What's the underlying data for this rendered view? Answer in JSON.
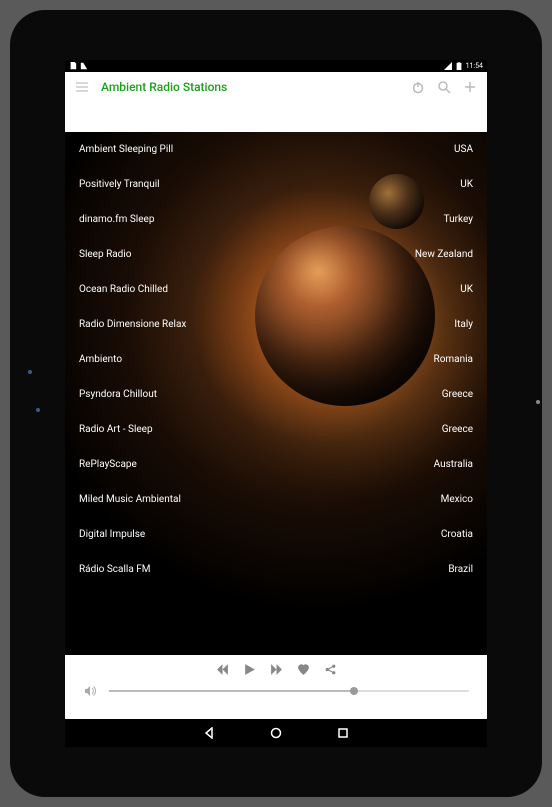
{
  "statusbar": {
    "time": "11:54"
  },
  "header": {
    "title": "Ambient Radio Stations"
  },
  "stations": [
    {
      "name": "Ambient Sleeping Pill",
      "country": "USA"
    },
    {
      "name": "Positively Tranquil",
      "country": "UK"
    },
    {
      "name": "dinamo.fm Sleep",
      "country": "Turkey"
    },
    {
      "name": "Sleep Radio",
      "country": "New Zealand"
    },
    {
      "name": "Ocean Radio Chilled",
      "country": "UK"
    },
    {
      "name": "Radio Dimensione Relax",
      "country": "Italy"
    },
    {
      "name": "Ambiento",
      "country": "Romania"
    },
    {
      "name": "Psyndora Chillout",
      "country": "Greece"
    },
    {
      "name": "Radio Art - Sleep",
      "country": "Greece"
    },
    {
      "name": "RePlayScape",
      "country": "Australia"
    },
    {
      "name": "Miled Music Ambiental",
      "country": "Mexico"
    },
    {
      "name": "Digital Impulse",
      "country": "Croatia"
    },
    {
      "name": "Rádio Scalla FM",
      "country": "Brazil"
    }
  ]
}
